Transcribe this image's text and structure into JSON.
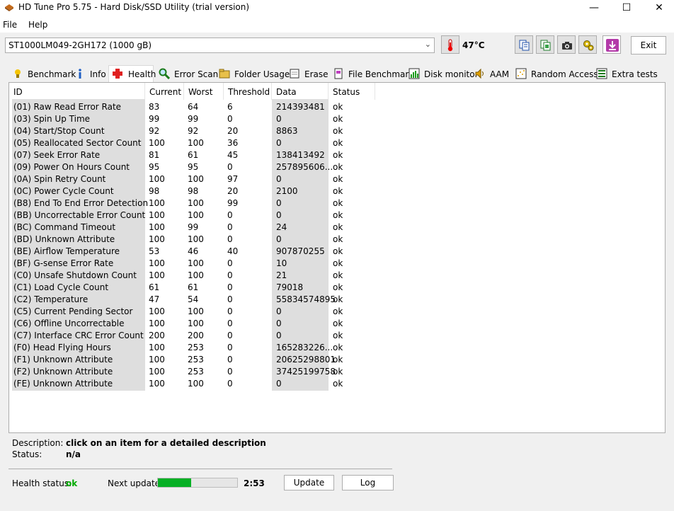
{
  "window": {
    "title": "HD Tune Pro 5.75 - Hard Disk/SSD Utility (trial version)",
    "minimize": "—",
    "maximize": "☐",
    "close": "✕"
  },
  "menu": [
    {
      "label": "File"
    },
    {
      "label": "Help"
    }
  ],
  "toolbar": {
    "drive": "ST1000LM049-2GH172 (1000 gB)",
    "temperature": "47°C",
    "exit_label": "Exit",
    "icons": [
      "copy-text-icon",
      "copy-screenshot-icon",
      "camera-icon",
      "options-icon",
      "download-icon"
    ]
  },
  "tabs": [
    {
      "label": "Benchmark",
      "icon": "benchmark-icon"
    },
    {
      "label": "Info",
      "icon": "info-icon"
    },
    {
      "label": "Health",
      "icon": "health-cross-icon",
      "active": true
    },
    {
      "label": "Error Scan",
      "icon": "magnifier-icon"
    },
    {
      "label": "Folder Usage",
      "icon": "folder-icon"
    },
    {
      "label": "Erase",
      "icon": "erase-icon"
    },
    {
      "label": "File Benchmark",
      "icon": "file-benchmark-icon"
    },
    {
      "label": "Disk monitor",
      "icon": "disk-monitor-icon"
    },
    {
      "label": "AAM",
      "icon": "speaker-icon"
    },
    {
      "label": "Random Access",
      "icon": "random-access-icon"
    },
    {
      "label": "Extra tests",
      "icon": "extra-tests-icon"
    }
  ],
  "table": {
    "headers": [
      "ID",
      "Current",
      "Worst",
      "Threshold",
      "Data",
      "Status"
    ],
    "rows": [
      [
        "(01) Raw Read Error Rate",
        "83",
        "64",
        "6",
        "214393481",
        "ok"
      ],
      [
        "(03) Spin Up Time",
        "99",
        "99",
        "0",
        "0",
        "ok"
      ],
      [
        "(04) Start/Stop Count",
        "92",
        "92",
        "20",
        "8863",
        "ok"
      ],
      [
        "(05) Reallocated Sector Count",
        "100",
        "100",
        "36",
        "0",
        "ok"
      ],
      [
        "(07) Seek Error Rate",
        "81",
        "61",
        "45",
        "138413492",
        "ok"
      ],
      [
        "(09) Power On Hours Count",
        "95",
        "95",
        "0",
        "257895606...",
        "ok"
      ],
      [
        "(0A) Spin Retry Count",
        "100",
        "100",
        "97",
        "0",
        "ok"
      ],
      [
        "(0C) Power Cycle Count",
        "98",
        "98",
        "20",
        "2100",
        "ok"
      ],
      [
        "(B8) End To End Error Detection",
        "100",
        "100",
        "99",
        "0",
        "ok"
      ],
      [
        "(BB) Uncorrectable Error Count",
        "100",
        "100",
        "0",
        "0",
        "ok"
      ],
      [
        "(BC) Command Timeout",
        "100",
        "99",
        "0",
        "24",
        "ok"
      ],
      [
        "(BD) Unknown Attribute",
        "100",
        "100",
        "0",
        "0",
        "ok"
      ],
      [
        "(BE) Airflow Temperature",
        "53",
        "46",
        "40",
        "907870255",
        "ok"
      ],
      [
        "(BF) G-sense Error Rate",
        "100",
        "100",
        "0",
        "10",
        "ok"
      ],
      [
        "(C0) Unsafe Shutdown Count",
        "100",
        "100",
        "0",
        "21",
        "ok"
      ],
      [
        "(C1) Load Cycle Count",
        "61",
        "61",
        "0",
        "79018",
        "ok"
      ],
      [
        "(C2) Temperature",
        "47",
        "54",
        "0",
        "55834574895",
        "ok"
      ],
      [
        "(C5) Current Pending Sector",
        "100",
        "100",
        "0",
        "0",
        "ok"
      ],
      [
        "(C6) Offline Uncorrectable",
        "100",
        "100",
        "0",
        "0",
        "ok"
      ],
      [
        "(C7) Interface CRC Error Count",
        "200",
        "200",
        "0",
        "0",
        "ok"
      ],
      [
        "(F0) Head Flying Hours",
        "100",
        "253",
        "0",
        "165283226...",
        "ok"
      ],
      [
        "(F1) Unknown Attribute",
        "100",
        "253",
        "0",
        "20625298801",
        "ok"
      ],
      [
        "(F2) Unknown Attribute",
        "100",
        "253",
        "0",
        "37425199758",
        "ok"
      ],
      [
        "(FE) Unknown Attribute",
        "100",
        "100",
        "0",
        "0",
        "ok"
      ]
    ]
  },
  "description": {
    "label": "Description:",
    "value": "click on an item for a detailed description"
  },
  "status": {
    "label": "Status:",
    "value": "n/a"
  },
  "health": {
    "label": "Health status:",
    "value": "ok",
    "color": "#00aa00"
  },
  "next_update": {
    "label": "Next update:",
    "progress": 0.42,
    "time": "2:53"
  },
  "buttons": {
    "update": "Update",
    "log": "Log"
  }
}
